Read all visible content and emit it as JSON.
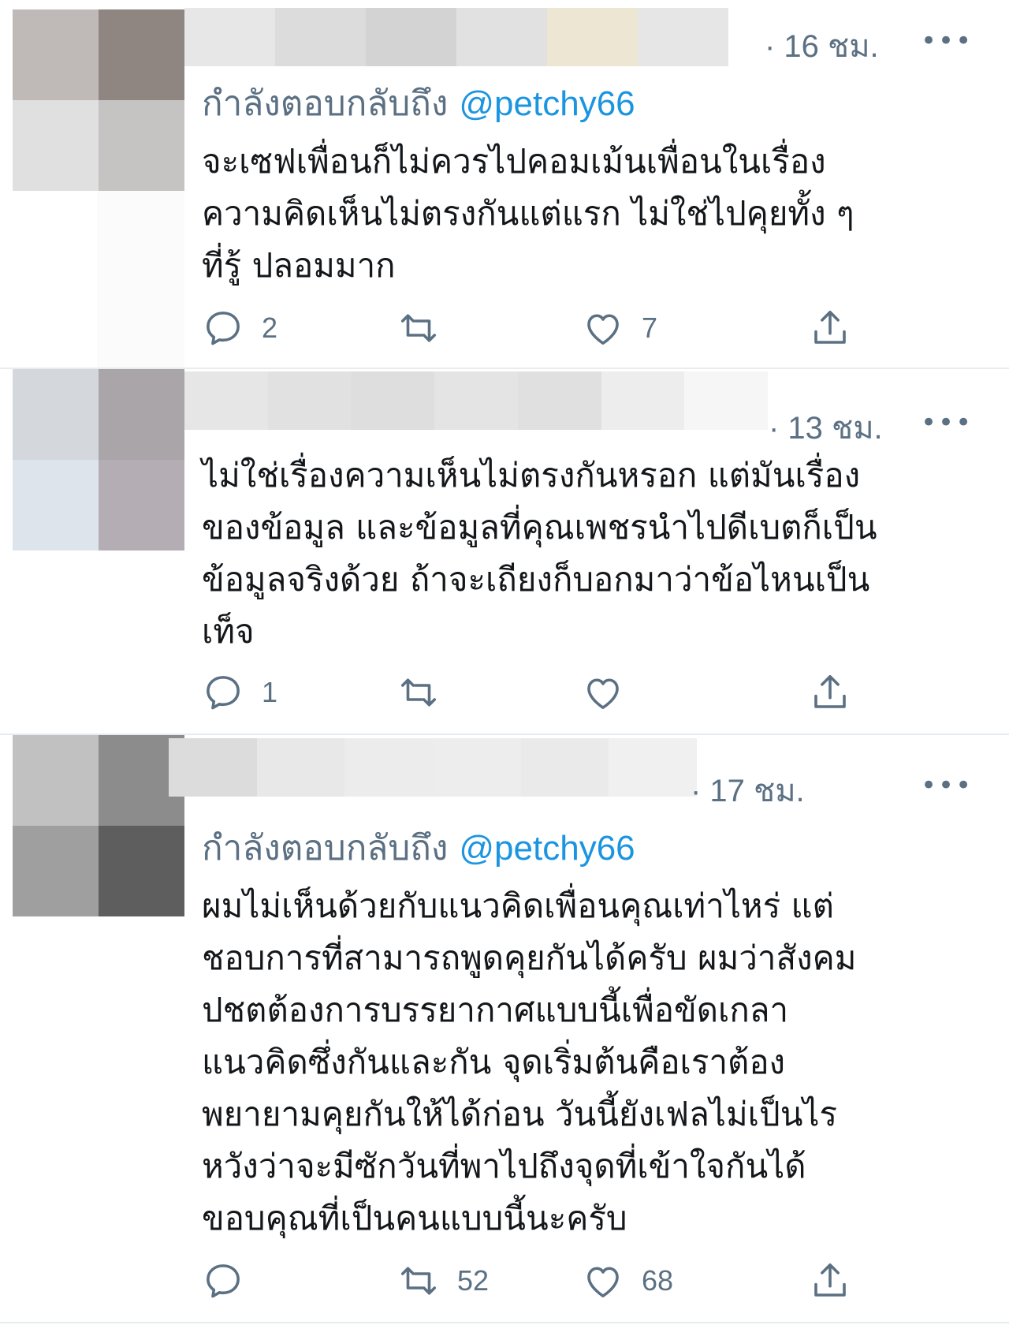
{
  "colors": {
    "accent": "#1b95e0",
    "muted": "#5b7083",
    "text": "#14171a",
    "divider": "#e6ecf0"
  },
  "tweets": [
    {
      "time": "· 16 ชม.",
      "more": "•••",
      "reply_prefix": "กำลังตอบกลับถึง",
      "reply_handle": "@petchy66",
      "lines": [
        "จะเซฟเพื่อนก็ไม่ควรไปคอมเม้นเพื่อนในเรื่อง",
        "ความคิดเห็นไม่ตรงกันแต่แรก ไม่ใช่ไปคุยทั้ง ๆ",
        "ที่รู้ ปลอมมาก"
      ],
      "replies": "2",
      "retweets": "",
      "likes": "7",
      "icons": [
        "reply-icon",
        "retweet-icon",
        "like-icon",
        "share-icon"
      ]
    },
    {
      "time": "· 13 ชม.",
      "more": "•••",
      "lines": [
        "ไม่ใช่เรื่องความเห็นไม่ตรงกันหรอก แต่มันเรื่อง",
        "ของข้อมูล และข้อมูลที่คุณเพชรนำไปดีเบตก็เป็น",
        "ข้อมูลจริงด้วย ถ้าจะเถียงก็บอกมาว่าข้อไหนเป็น",
        "เท็จ"
      ],
      "replies": "1",
      "retweets": "",
      "likes": "",
      "icons": [
        "reply-icon",
        "retweet-icon",
        "like-icon",
        "share-icon"
      ]
    },
    {
      "time": "· 17 ชม.",
      "more": "•••",
      "reply_prefix": "กำลังตอบกลับถึง",
      "reply_handle": "@petchy66",
      "lines": [
        "ผมไม่เห็นด้วยกับแนวคิดเพื่อนคุณเท่าไหร่ แต่",
        "ชอบการที่สามารถพูดคุยกันได้ครับ  ผมว่าสังคม",
        "ปชตต้องการบรรยากาศแบบนี้เพื่อขัดเกลา",
        "แนวคิดซึ่งกันและกัน จุดเริ่มต้นคือเราต้อง",
        "พยายามคุยกันให้ได้ก่อน วันนี้ยังเฟลไม่เป็นไร",
        "หวังว่าจะมีซักวันที่พาไปถึงจุดที่เข้าใจกันได้",
        "ขอบคุณที่เป็นคนแบบนี้นะครับ"
      ],
      "replies": "",
      "retweets": "52",
      "likes": "68",
      "icons": [
        "reply-icon",
        "retweet-icon",
        "like-icon",
        "share-icon"
      ]
    }
  ]
}
